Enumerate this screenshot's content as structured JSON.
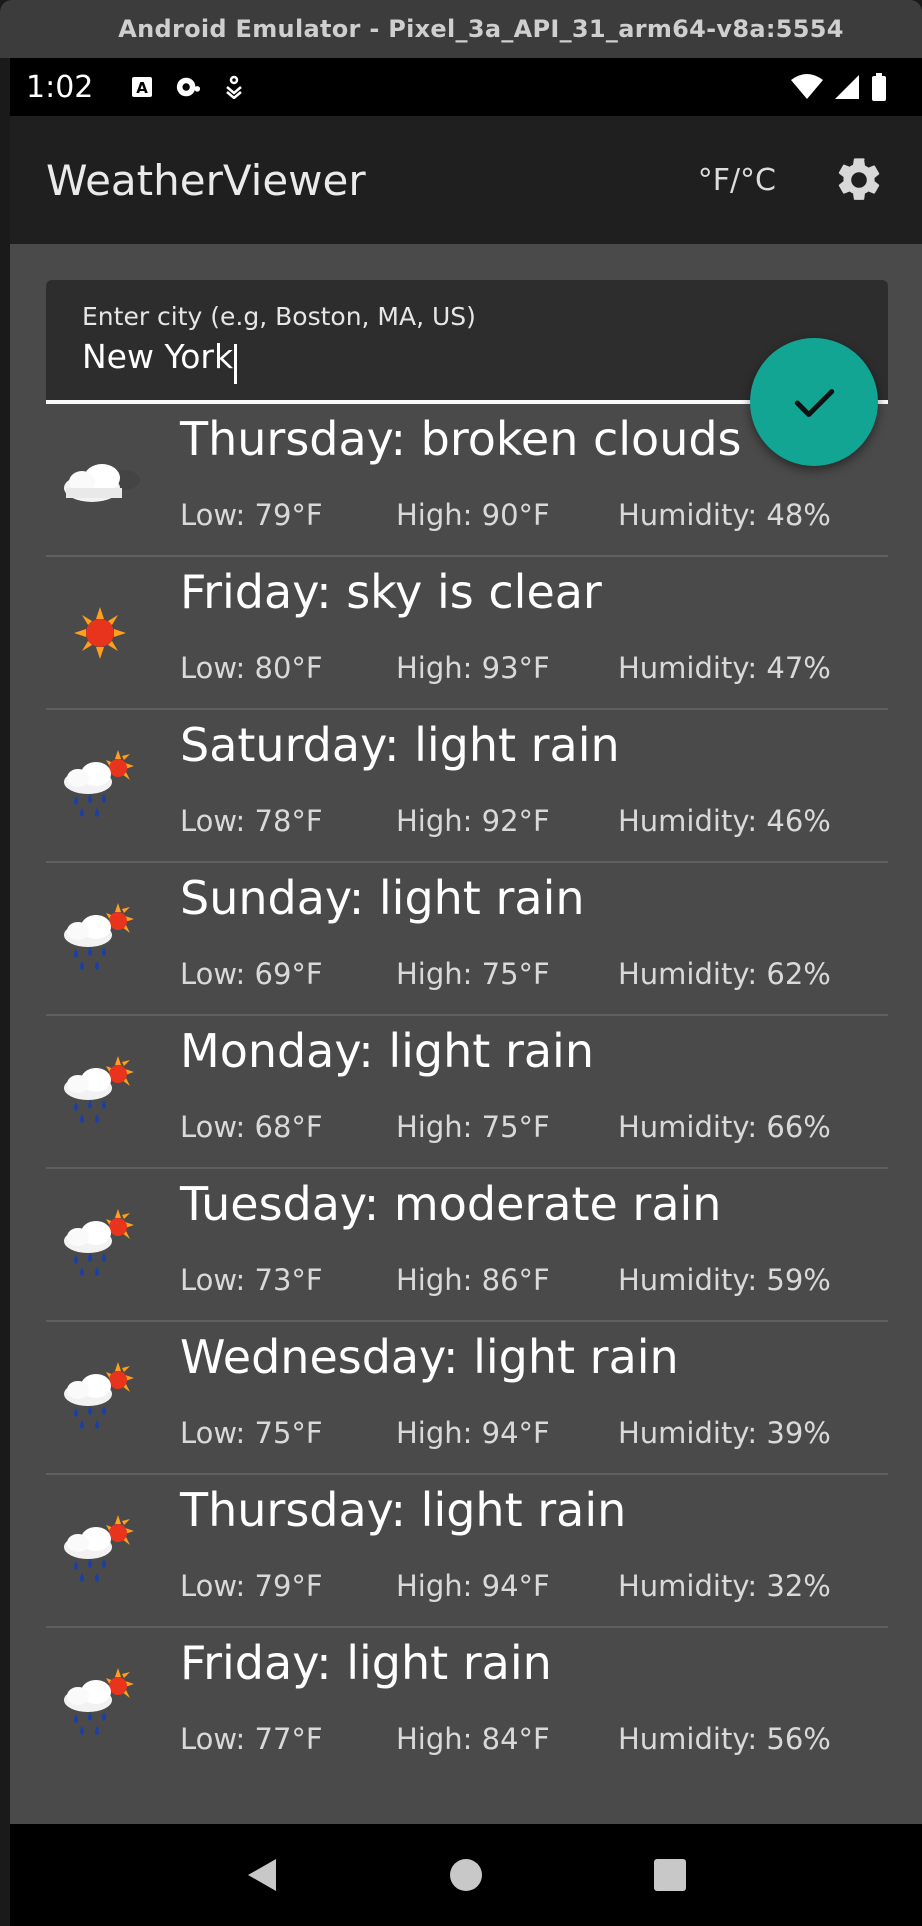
{
  "window": {
    "title": "Android Emulator - Pixel_3a_API_31_arm64-v8a:5554"
  },
  "statusbar": {
    "time": "1:02",
    "left_icons": [
      "font-accessibility-icon",
      "notification-dot-icon",
      "download-icon"
    ],
    "right_icons": [
      "wifi-icon",
      "cellular-signal-icon",
      "battery-icon"
    ]
  },
  "appbar": {
    "title": "WeatherViewer",
    "units_label": "°F/°C",
    "settings_icon": "gear-icon"
  },
  "city": {
    "label": "Enter city (e.g, Boston, MA, US)",
    "value": "New York"
  },
  "fab": {
    "icon": "checkmark-icon",
    "color": "#12a594"
  },
  "forecast": [
    {
      "day": "Thursday: broken clouds",
      "icon": "broken-clouds-icon",
      "low": "Low: 79°F",
      "high": "High: 90°F",
      "humidity": "Humidity: 48%"
    },
    {
      "day": "Friday: sky is clear",
      "icon": "clear-sky-icon",
      "low": "Low: 80°F",
      "high": "High: 93°F",
      "humidity": "Humidity: 47%"
    },
    {
      "day": "Saturday: light rain",
      "icon": "light-rain-icon",
      "low": "Low: 78°F",
      "high": "High: 92°F",
      "humidity": "Humidity: 46%"
    },
    {
      "day": "Sunday: light rain",
      "icon": "light-rain-icon",
      "low": "Low: 69°F",
      "high": "High: 75°F",
      "humidity": "Humidity: 62%"
    },
    {
      "day": "Monday: light rain",
      "icon": "light-rain-icon",
      "low": "Low: 68°F",
      "high": "High: 75°F",
      "humidity": "Humidity: 66%"
    },
    {
      "day": "Tuesday: moderate rain",
      "icon": "light-rain-icon",
      "low": "Low: 73°F",
      "high": "High: 86°F",
      "humidity": "Humidity: 59%"
    },
    {
      "day": "Wednesday: light rain",
      "icon": "light-rain-icon",
      "low": "Low: 75°F",
      "high": "High: 94°F",
      "humidity": "Humidity: 39%"
    },
    {
      "day": "Thursday: light rain",
      "icon": "light-rain-icon",
      "low": "Low: 79°F",
      "high": "High: 94°F",
      "humidity": "Humidity: 32%"
    },
    {
      "day": "Friday: light rain",
      "icon": "light-rain-icon",
      "low": "Low: 77°F",
      "high": "High: 84°F",
      "humidity": "Humidity: 56%"
    }
  ],
  "navbar": {
    "icons": [
      "back-icon",
      "home-icon",
      "recents-icon"
    ]
  },
  "colors": {
    "accent": "#12a594",
    "background": "#4a4a4a",
    "appbar": "#1f1f1f"
  }
}
